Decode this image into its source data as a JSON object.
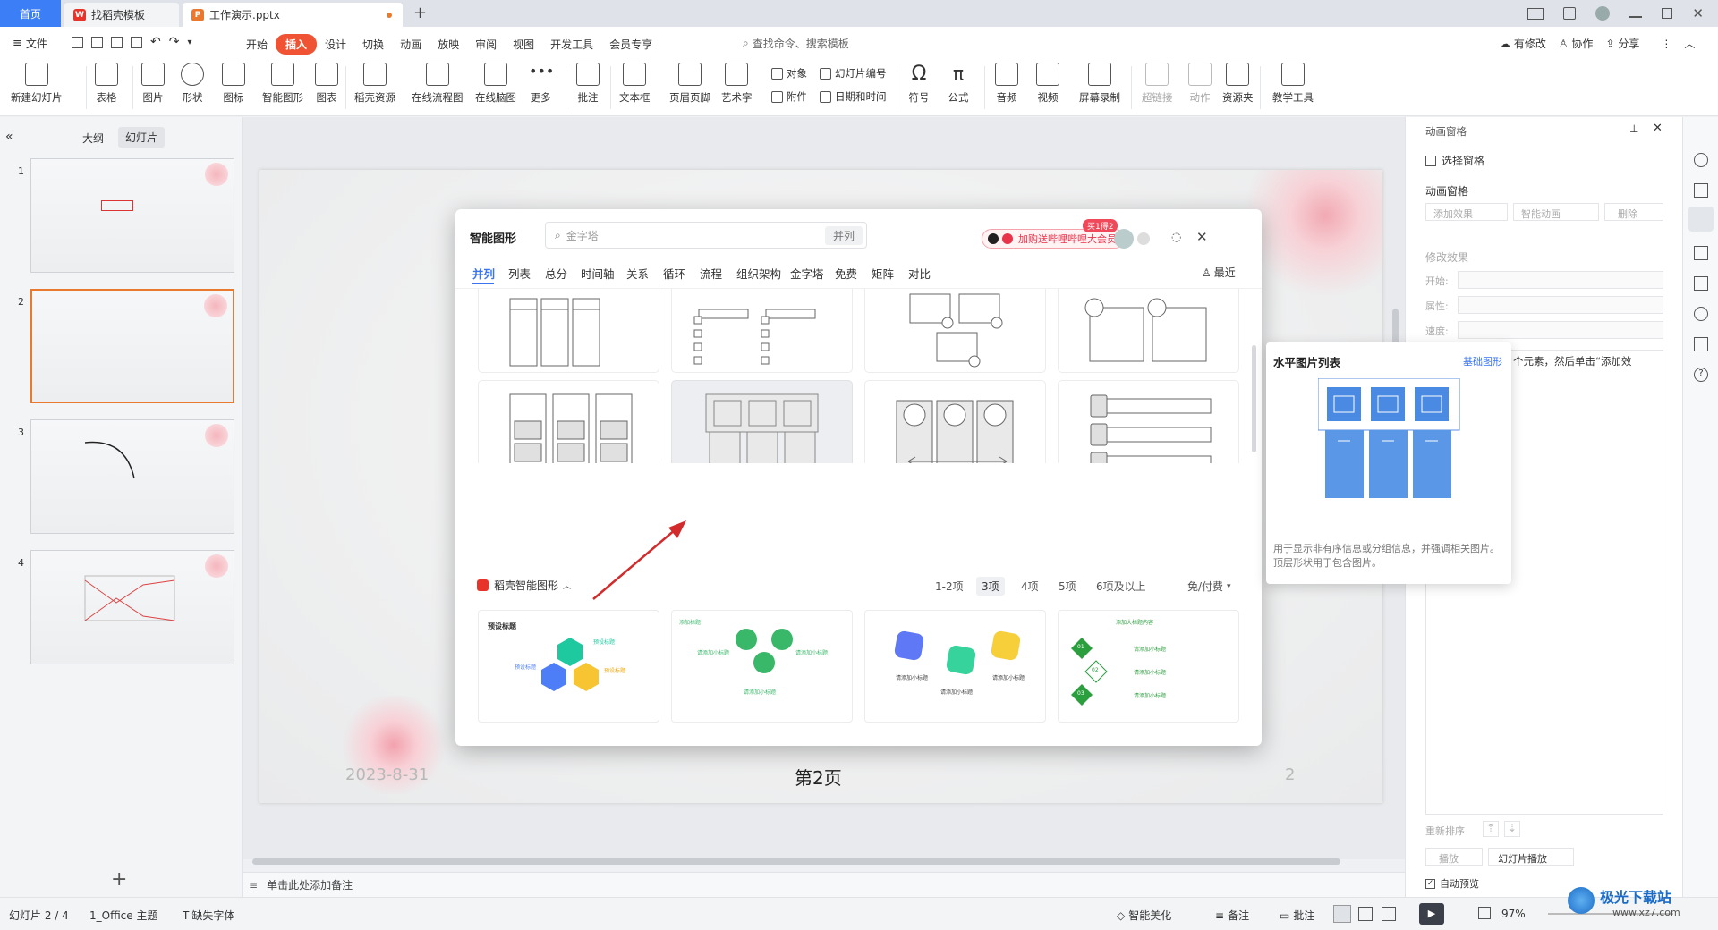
{
  "tabs": {
    "home": "首页",
    "template": "找稻壳模板",
    "doc": "工作演示.pptx",
    "add": "+"
  },
  "menu": {
    "file": "文件",
    "items": [
      "开始",
      "插入",
      "设计",
      "切换",
      "动画",
      "放映",
      "审阅",
      "视图",
      "开发工具",
      "会员专享"
    ],
    "active_index": 1,
    "search": "查找命令、搜索模板",
    "modified": "有修改",
    "collab": "协作",
    "share": "分享"
  },
  "ribbon": {
    "new_slide": "新建幻灯片",
    "table": "表格",
    "picture": "图片",
    "shape": "形状",
    "icon": "图标",
    "smart": "智能图形",
    "chart": "图表",
    "docer": "稻壳资源",
    "flow": "在线流程图",
    "mind": "在线脑图",
    "more": "更多",
    "comment": "批注",
    "textbox": "文本框",
    "header": "页眉页脚",
    "art": "艺术字",
    "object": "对象",
    "attach": "附件",
    "slideno": "幻灯片编号",
    "datetime": "日期和时间",
    "symbol": "符号",
    "formula": "公式",
    "audio": "音频",
    "video": "视频",
    "record": "屏幕录制",
    "hyperlink": "超链接",
    "action": "动作",
    "resource": "资源夹",
    "teach": "教学工具"
  },
  "leftpanel": {
    "tab_outline": "大纲",
    "tab_slides": "幻灯片",
    "nums": [
      "1",
      "2",
      "3",
      "4"
    ],
    "add": "+"
  },
  "slide": {
    "date": "2023-8-31",
    "title": "第2页",
    "num": "2"
  },
  "notes": "单击此处添加备注",
  "rightpane": {
    "header": "动画窗格",
    "select_pane": "选择窗格",
    "anim_pane": "动画窗格",
    "add_effect": "添加效果",
    "smart_anim": "智能动画",
    "delete": "删除",
    "modify": "修改效果",
    "start": "开始:",
    "prop": "属性:",
    "speed": "速度:",
    "hint": "个元素，然后单击“添加效",
    "reorder": "重新排序",
    "play": "播放",
    "slideshow": "幻灯片播放",
    "autopreview": "自动预览"
  },
  "status": {
    "slide": "幻灯片 2 / 4",
    "theme": "1_Office 主题",
    "font": "缺失字体",
    "beautify": "智能美化",
    "notes": "备注",
    "comment": "批注",
    "zoom": "97%"
  },
  "dialog": {
    "title": "智能图形",
    "search_placeholder": "金字塔",
    "search_tag": "并列",
    "promo_badge": "买1得2",
    "promo": "加购送哔哩哔哩大会员",
    "recent": "最近",
    "categories": [
      "并列",
      "列表",
      "总分",
      "时间轴",
      "关系",
      "循环",
      "流程",
      "组织架构",
      "金字塔",
      "免费",
      "矩阵",
      "对比"
    ],
    "active_category": 0,
    "section": "稻壳智能图形",
    "counts": [
      "1-2项",
      "3项",
      "4项",
      "5项",
      "6项及以上"
    ],
    "active_count": 1,
    "filter": "免/付费",
    "template_texts": {
      "c1_title": "预设标题",
      "c1_a": "预设标题",
      "c1_b": "预设标题",
      "c1_c": "预设标题",
      "c2_top": "添加标题",
      "c2_a": "请添加小标题",
      "c2_b": "请添加小标题",
      "c2_c": "请添加小标题",
      "c3_a": "请添加小标题",
      "c3_b": "请添加小标题",
      "c3_c": "请添加小标题",
      "c4_title": "添加大标题内容",
      "c4_n1": "01",
      "c4_n2": "02",
      "c4_n3": "03",
      "c4_a": "请添加小标题",
      "c4_b": "请添加小标题",
      "c4_c": "请添加小标题"
    }
  },
  "tooltip": {
    "title": "水平图片列表",
    "link": "基础图形",
    "desc": "用于显示非有序信息或分组信息，并强调相关图片。顶层形状用于包含图片。"
  },
  "watermark": {
    "text": "极光下载站",
    "url": "www.xz7.com"
  },
  "colors": {
    "accent_blue": "#3a74f1",
    "insert_red": "#ef5334",
    "arrow_red": "#d22b2b",
    "thumb_selected": "#e8792e"
  }
}
